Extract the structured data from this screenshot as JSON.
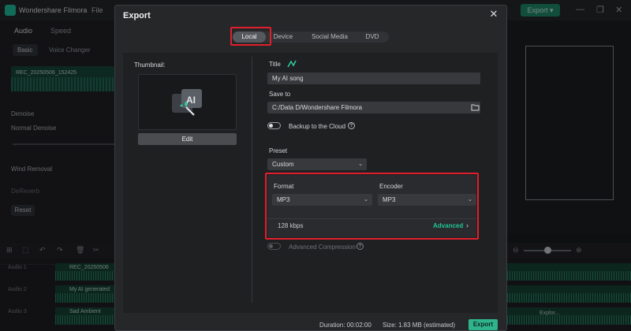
{
  "app": {
    "name": "Wondershare Filmora",
    "menu_file": "File",
    "export_label": "Export",
    "window_controls": [
      "—",
      "❐",
      "✕"
    ]
  },
  "left_panel": {
    "tabs": [
      "Audio",
      "Speed"
    ],
    "subtabs": [
      "Basic",
      "Voice Changer"
    ],
    "clip_name": "REC_20250506_152425",
    "labels": {
      "denoise": "Denoise",
      "normal_denoise": "Normal Denoise",
      "wind_removal": "Wind Removal",
      "dereverb": "DeReverb"
    },
    "reset_label": "Reset"
  },
  "timeline": {
    "tracks": [
      {
        "name": "Audio 1",
        "clip": "REC_20250506"
      },
      {
        "name": "Audio 2",
        "clip": "My AI generated"
      },
      {
        "name": "Audio 3",
        "clip": "Sad Ambient"
      }
    ],
    "clip_right": "Explor..."
  },
  "dialog": {
    "title": "Export",
    "tabs": [
      {
        "label": "Local",
        "active": true
      },
      {
        "label": "Device",
        "active": false
      },
      {
        "label": "Social Media",
        "active": false
      },
      {
        "label": "DVD",
        "active": false
      }
    ],
    "thumbnail_label": "Thumbnail:",
    "edit_label": "Edit",
    "title_label": "Title",
    "title_value": "My AI song",
    "save_to_label": "Save to",
    "save_to_value": "C:/Data D/Wondershare Filmora",
    "backup_label": "Backup to the Cloud",
    "preset_label": "Preset",
    "preset_value": "Custom",
    "format_label": "Format",
    "format_value": "MP3",
    "encoder_label": "Encoder",
    "encoder_value": "MP3",
    "bitrate": "128 kbps",
    "advanced_label": "Advanced",
    "advanced_compression_label": "Advanced Compression",
    "duration_text": "Duration: 00:02:00",
    "size_text": "Size:  1.83 MB (estimated)",
    "export_label": "Export"
  },
  "colors": {
    "accent_green": "#2fb38c",
    "highlight_red": "#e11f2c"
  }
}
